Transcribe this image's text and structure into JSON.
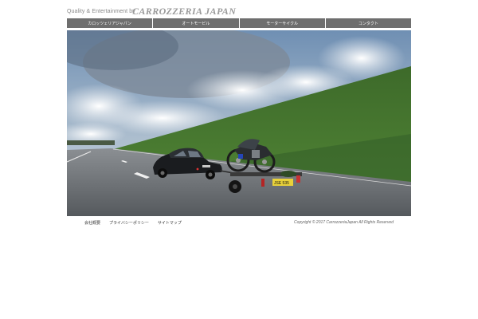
{
  "header": {
    "tagline": "Quality & Entertainment by",
    "brand": "CARROZZERIA JAPAN"
  },
  "nav": {
    "items": [
      {
        "label": "カロッツェリアジャパン"
      },
      {
        "label": "オートモービル"
      },
      {
        "label": "モーターサイクル"
      },
      {
        "label": "コンタクト"
      }
    ]
  },
  "hero": {
    "license_plate": "JSE 535"
  },
  "footer": {
    "links": [
      {
        "label": "会社概要"
      },
      {
        "label": "プライバシーポリシー"
      },
      {
        "label": "サイトマップ"
      }
    ],
    "copyright": "Copyright © 2017 CarrozzeriaJapan All Rights Reserved"
  },
  "colors": {
    "nav_bg": "#6e6e6e",
    "sky": "#8fa9c4",
    "grass": "#3f6e2c",
    "road": "#5f6366"
  }
}
